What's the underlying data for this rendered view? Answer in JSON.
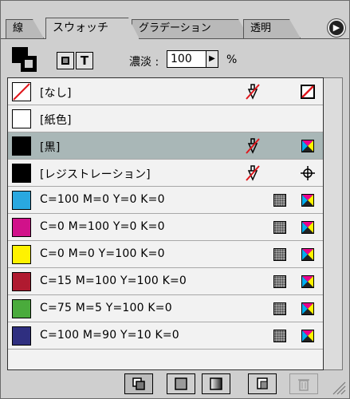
{
  "tabs": [
    {
      "label": "線",
      "active": false
    },
    {
      "label": "スウォッチ",
      "active": true
    },
    {
      "label": "グラデーション",
      "active": false
    },
    {
      "label": "透明",
      "active": false
    }
  ],
  "toolbar": {
    "fill_stroke_icon": "fill-stroke-icon",
    "fill_button_icon": "fill-container-icon",
    "text_button_label": "T",
    "tint_label": "濃淡 :",
    "tint_value": "100",
    "tint_unit": "%"
  },
  "swatches": [
    {
      "label": "[なし]",
      "color": "none",
      "no_edit": true,
      "mode": "none",
      "selected": false
    },
    {
      "label": "[紙色]",
      "color": "#ffffff",
      "no_edit": false,
      "mode": "",
      "selected": false
    },
    {
      "label": "[黒]",
      "color": "#000000",
      "no_edit": true,
      "mode": "cmyk",
      "selected": true
    },
    {
      "label": "[レジストレーション]",
      "color": "#000000",
      "no_edit": true,
      "mode": "registration",
      "selected": false
    },
    {
      "label": "C=100 M=0 Y=0 K=0",
      "color": "#29a8e0",
      "no_edit": false,
      "mode": "cmyk",
      "process": true,
      "selected": false
    },
    {
      "label": "C=0 M=100 Y=0 K=0",
      "color": "#d1118a",
      "no_edit": false,
      "mode": "cmyk",
      "process": true,
      "selected": false
    },
    {
      "label": "C=0 M=0 Y=100 K=0",
      "color": "#fff200",
      "no_edit": false,
      "mode": "cmyk",
      "process": true,
      "selected": false
    },
    {
      "label": "C=15 M=100 Y=100 K=0",
      "color": "#b01a30",
      "no_edit": false,
      "mode": "cmyk",
      "process": true,
      "selected": false
    },
    {
      "label": "C=75 M=5 Y=100 K=0",
      "color": "#4aab3c",
      "no_edit": false,
      "mode": "cmyk",
      "process": true,
      "selected": false
    },
    {
      "label": "C=100 M=90 Y=10 K=0",
      "color": "#2f2f80",
      "no_edit": false,
      "mode": "cmyk",
      "process": true,
      "selected": false
    }
  ],
  "bottom_buttons": [
    {
      "name": "show-all-swatches-button",
      "icon": "show-all-icon"
    },
    {
      "name": "show-color-swatches-button",
      "icon": "color-swatch-icon"
    },
    {
      "name": "show-gradient-swatches-button",
      "icon": "gradient-swatch-icon"
    },
    {
      "name": "new-swatch-button",
      "icon": "new-swatch-icon"
    },
    {
      "name": "delete-swatch-button",
      "icon": "trash-icon"
    }
  ]
}
